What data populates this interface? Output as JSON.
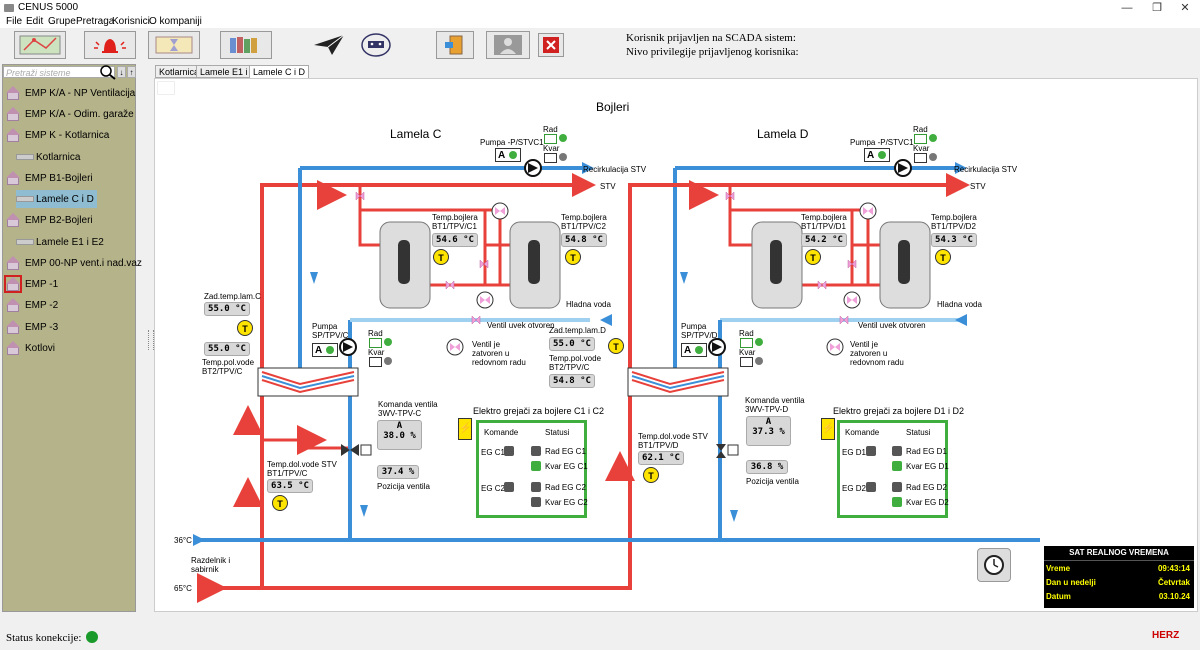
{
  "window": {
    "title": "CENUS 5000",
    "min": "—",
    "max": "❐",
    "close": "✕"
  },
  "menu": [
    "File",
    "Edit",
    "Grupe",
    "Pretraga",
    "Korisnici",
    "O kompaniji"
  ],
  "login": {
    "user_line": "Korisnik prijavljen na SCADA sistem:",
    "priv_line": "Nivo privilegije prijavljenog korisnika:"
  },
  "search": {
    "placeholder": "Pretraži sisteme"
  },
  "sidebar": {
    "items": [
      {
        "label": "EMP K/A - NP Ventilacija",
        "level": 0
      },
      {
        "label": "EMP K/A - Odim. garaže",
        "level": 0
      },
      {
        "label": "EMP K - Kotlarnica",
        "level": 0
      },
      {
        "label": "Kotlarnica",
        "level": 1
      },
      {
        "label": "EMP B1-Bojleri",
        "level": 0
      },
      {
        "label": "Lamele C i D",
        "level": 1,
        "selected": true
      },
      {
        "label": "EMP B2-Bojleri",
        "level": 0
      },
      {
        "label": "Lamele E1 i E2",
        "level": 1
      },
      {
        "label": "EMP 00-NP vent.i nad.vaz",
        "level": 0
      },
      {
        "label": "EMP -1",
        "level": 0
      },
      {
        "label": "EMP -2",
        "level": 0
      },
      {
        "label": "EMP -3",
        "level": 0
      },
      {
        "label": "Kotlovi",
        "level": 0
      }
    ]
  },
  "tabs": [
    "Kotlarnica",
    "Lamele E1 i E2",
    "Lamele C i D"
  ],
  "scada": {
    "title": "Bojleri",
    "lamelaC": "Lamela C",
    "lamelaD": "Lamela D",
    "recirc": "Recirkulacija STV",
    "stv": "STV",
    "hladna": "Hladna voda",
    "ventil_otvoren": "Ventil uvek otvoren",
    "ventil_zatvoren": "Ventil je zatvoren u redovnom radu",
    "pumpa_stvc1": "Pumpa -P/STVC1",
    "pumpa_stvd1": "Pumpa -P/STVC1",
    "rad": "Rad",
    "kvar": "Kvar",
    "pumpa_sptpvc": "Pumpa SP/TPV/C",
    "pumpa_sptpvd": "Pumpa SP/TPV/D",
    "mode_a": "A",
    "c1_label": "Temp.bojlera BT1/TPV/C1",
    "c1_val": "54.6 °C",
    "c2_label": "Temp.bojlera BT1/TPV/C2",
    "c2_val": "54.8 °C",
    "d1_label": "Temp.bojlera BT1/TPV/D1",
    "d1_val": "54.2 °C",
    "d2_label": "Temp.bojlera BT1/TPV/D2",
    "d2_val": "54.3 °C",
    "zadC_label": "Zad.temp.lam.C",
    "zadC_val": "55.0 °C",
    "polC_val": "55.0 °C",
    "polC_label": "Temp.pol.vode BT2/TPV/C",
    "zadD_label": "Zad.temp.lam.D",
    "zadD_val": "55.0 °C",
    "polD_label": "Temp.pol.vode BT2/TPV/C",
    "polD_val": "54.8 °C",
    "komandaC_label": "Komanda ventila 3WV-TPV-C",
    "komandaC_val": "38.0 %",
    "pozC_val": "37.4 %",
    "pozicija": "Pozicija ventila",
    "komandaD_label": "Komanda ventila 3WV-TPV-D",
    "komandaD_val": "37.3 %",
    "pozD_val": "36.8 %",
    "dolC_label": "Temp.dol.vode STV BT1/TPV/C",
    "dolC_val": "63.5 °C",
    "dolD_label": "Temp.dol.vode STV BT1/TPV/D",
    "dolD_val": "62.1 °C",
    "egC_title": "Elektro grejači za bojlere C1 i C2",
    "egD_title": "Elektro grejači za bojlere D1 i D2",
    "komande": "Komande",
    "statusi": "Statusi",
    "egc1": "EG C1",
    "egc2": "EG C2",
    "radegc1": "Rad EG C1",
    "kvaregc1": "Kvar EG C1",
    "radegc2": "Rad EG C2",
    "kvaregc2": "Kvar EG C2",
    "egd1": "EG D1",
    "egd2": "EG D2",
    "radegd1": "Rad EG D1",
    "kvaregd1": "Kvar EG D1",
    "radegd2": "Rad EG D2",
    "kvaregd2": "Kvar EG D2",
    "t36": "36°C",
    "t65": "65°C",
    "razdelnik": "Razdelnik i sabirnik",
    "t_symbol": "T"
  },
  "rtc": {
    "title": "SAT REALNOG VREMENA",
    "rows": [
      {
        "k": "Vreme",
        "v": "09:43:14"
      },
      {
        "k": "Dan u nedelji",
        "v": "Četvrtak"
      },
      {
        "k": "Datum",
        "v": "03.10.24"
      }
    ]
  },
  "status": {
    "label": "Status konekcije:",
    "brand": "HERZ"
  },
  "colors": {
    "red": "#e8403a",
    "blue": "#3a8fd8",
    "lightblue": "#9fd0f0",
    "green": "#3fae3f",
    "sidebar": "#b5b38a"
  }
}
